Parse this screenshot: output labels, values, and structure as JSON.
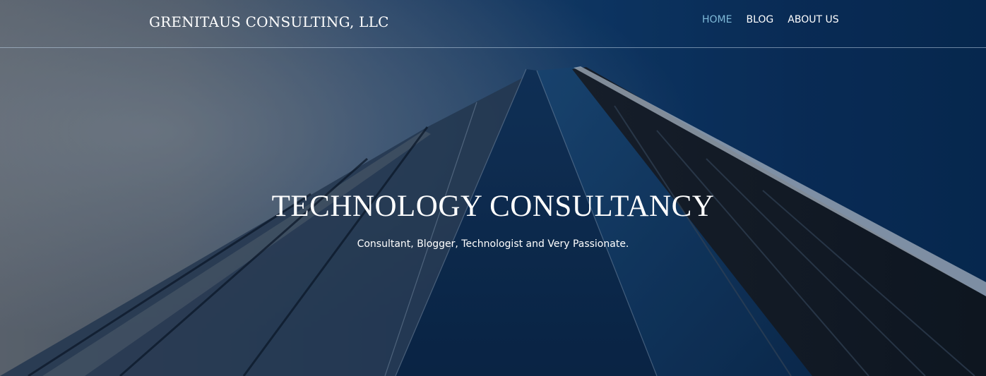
{
  "header": {
    "brand": "GRENITAUS CONSULTING, LLC",
    "nav": [
      {
        "label": "HOME",
        "active": true
      },
      {
        "label": "BLOG",
        "active": false
      },
      {
        "label": "ABOUT US",
        "active": false
      }
    ]
  },
  "hero": {
    "title": "TECHNOLOGY CONSULTANCY",
    "subtitle": "Consultant, Blogger, Technologist and Very Passionate.",
    "background_image": "skyscraper-icon"
  },
  "colors": {
    "nav_active": "#7fb9d8",
    "text": "#ffffff",
    "sky_left": "#6b7077",
    "sky_right": "#072a53"
  }
}
